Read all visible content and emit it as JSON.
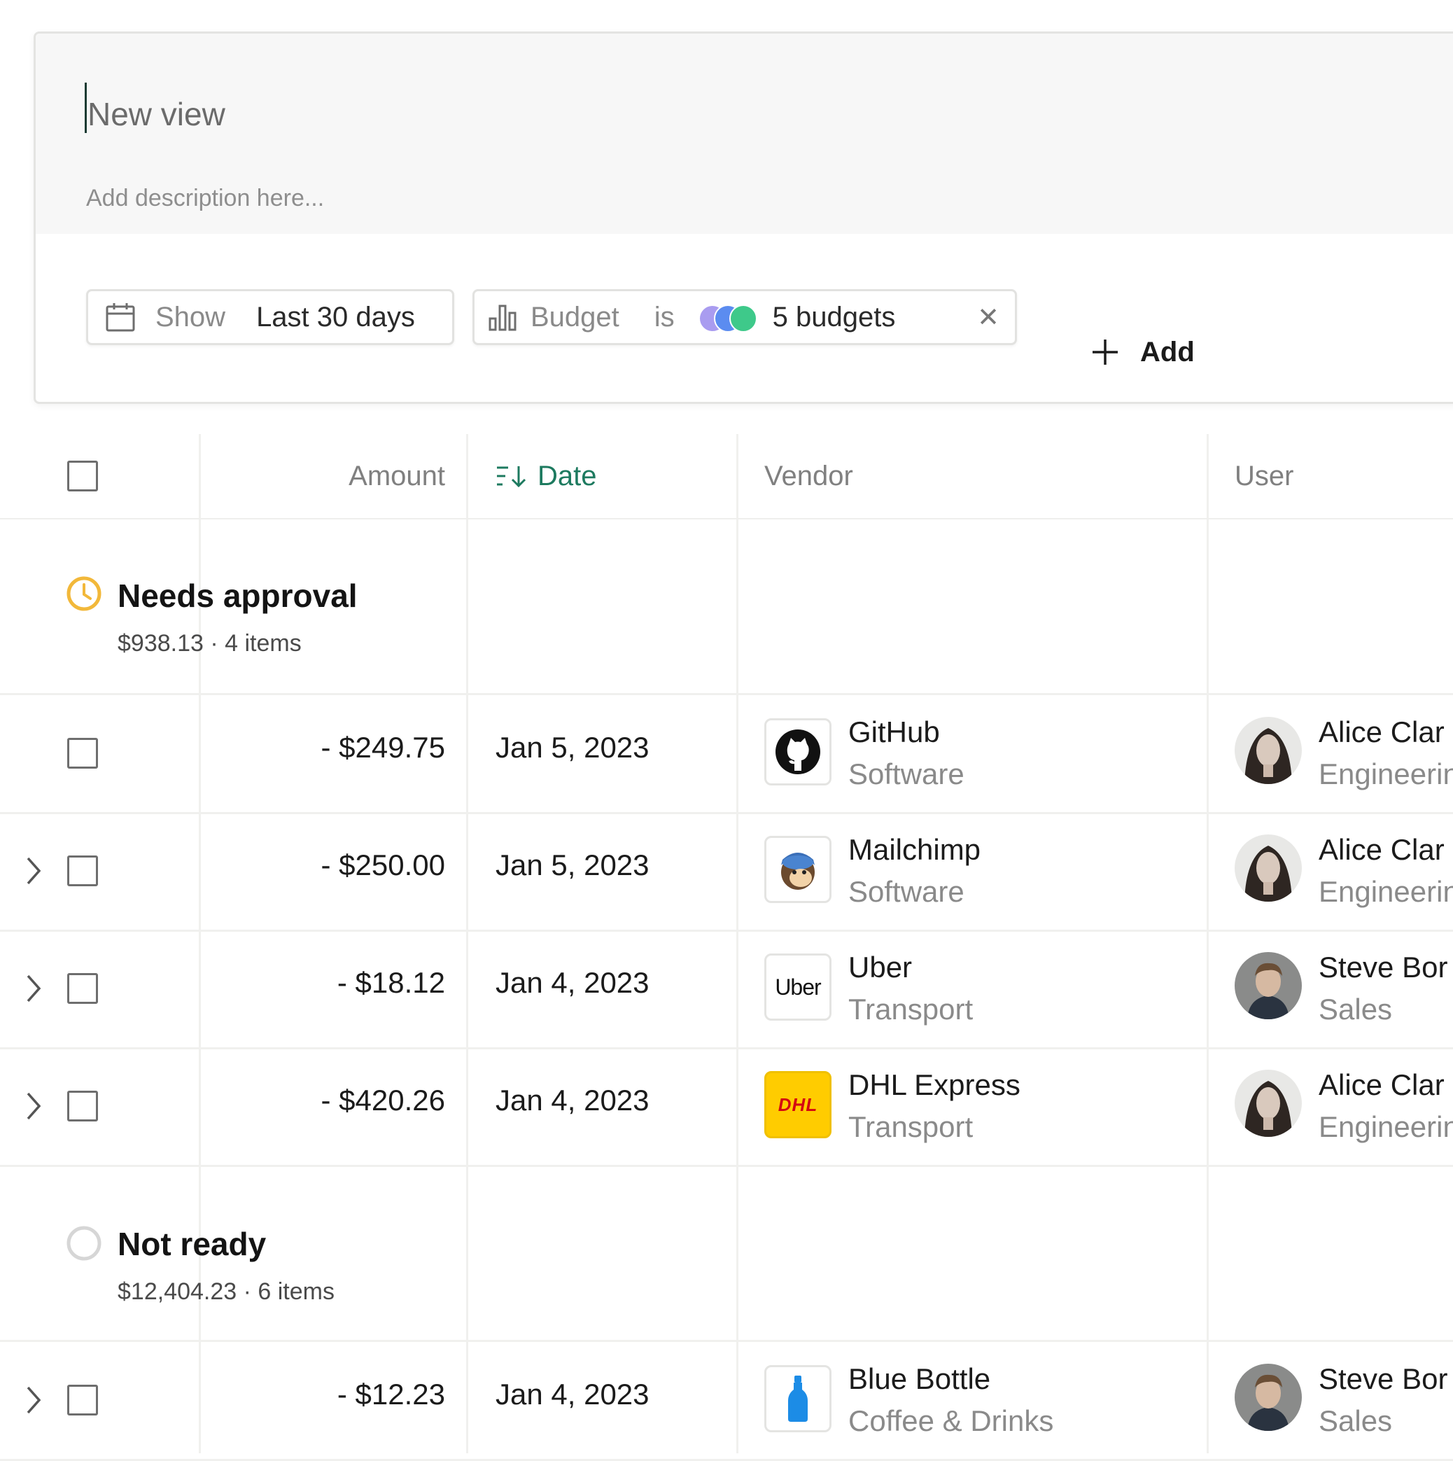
{
  "view": {
    "title_placeholder": "New view",
    "description_placeholder": "Add description here..."
  },
  "filters": {
    "date": {
      "label": "Show",
      "value": "Last 30 days"
    },
    "budget": {
      "label": "Budget",
      "operator": "is",
      "value": "5 budgets",
      "dot_colors": [
        "#a99cf0",
        "#5b8cf0",
        "#3ec98a"
      ]
    },
    "add_label": "Add"
  },
  "columns": {
    "amount": "Amount",
    "date": "Date",
    "vendor": "Vendor",
    "user": "User"
  },
  "colors": {
    "accent_green": "#1d7a5f",
    "pending_yellow": "#f2b83a",
    "not_ready_gray": "#d6d6d6"
  },
  "groups": [
    {
      "title": "Needs approval",
      "summary": "$938.13 · 4 items",
      "status_icon": "clock-icon",
      "rows": [
        {
          "amount": "- $249.75",
          "date": "Jan 5, 2023",
          "vendor": "GitHub",
          "category": "Software",
          "vendor_icon": "github-icon",
          "user": "Alice Clar",
          "department": "Engineerin",
          "avatar": "alice-avatar",
          "expandable": false
        },
        {
          "amount": "- $250.00",
          "date": "Jan 5, 2023",
          "vendor": "Mailchimp",
          "category": "Software",
          "vendor_icon": "mailchimp-icon",
          "user": "Alice Clar",
          "department": "Engineerin",
          "avatar": "alice-avatar",
          "expandable": true
        },
        {
          "amount": "- $18.12",
          "date": "Jan 4, 2023",
          "vendor": "Uber",
          "category": "Transport",
          "vendor_icon": "uber-logo",
          "logo_text": "Uber",
          "user": "Steve Bor",
          "department": "Sales",
          "avatar": "steve-avatar",
          "expandable": true
        },
        {
          "amount": "- $420.26",
          "date": "Jan 4, 2023",
          "vendor": "DHL Express",
          "category": "Transport",
          "vendor_icon": "dhl-logo",
          "logo_text": "DHL",
          "user": "Alice Clar",
          "department": "Engineerin",
          "avatar": "alice-avatar",
          "expandable": true
        }
      ]
    },
    {
      "title": "Not ready",
      "summary": "$12,404.23 · 6 items",
      "status_icon": "empty-circle-icon",
      "rows": [
        {
          "amount": "- $12.23",
          "date": "Jan 4, 2023",
          "vendor": "Blue Bottle",
          "category": "Coffee & Drinks",
          "vendor_icon": "blue-bottle-icon",
          "user": "Steve Bor",
          "department": "Sales",
          "avatar": "steve-avatar",
          "expandable": true
        }
      ]
    }
  ]
}
